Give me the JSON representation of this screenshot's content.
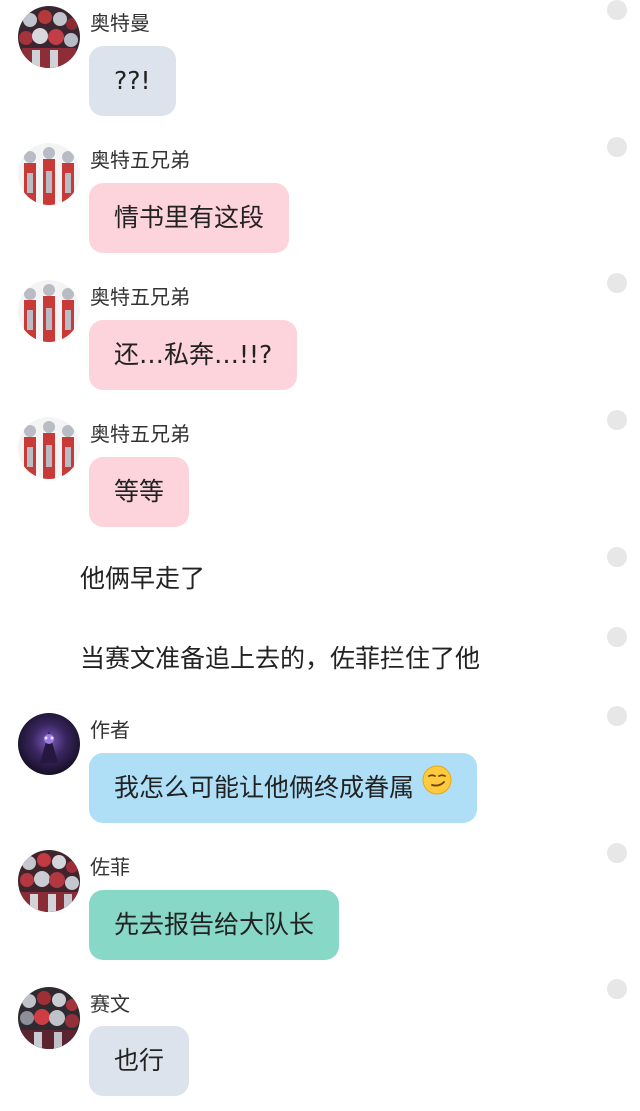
{
  "messages": [
    {
      "type": "chat",
      "speaker": "奥特曼",
      "text": "??!",
      "color": "#dde3ec",
      "avatar_icon": "ultraman-group-avatar-icon"
    },
    {
      "type": "chat",
      "speaker": "奥特五兄弟",
      "text": "情书里有这段",
      "color": "#fdd3dc",
      "avatar_icon": "ultra-brothers-avatar-icon"
    },
    {
      "type": "chat",
      "speaker": "奥特五兄弟",
      "text": "还…私奔…!!?",
      "color": "#fdd3dc",
      "avatar_icon": "ultra-brothers-avatar-icon"
    },
    {
      "type": "chat",
      "speaker": "奥特五兄弟",
      "text": "等等",
      "color": "#fdd3dc",
      "avatar_icon": "ultra-brothers-avatar-icon"
    },
    {
      "type": "narration",
      "text": "他俩早走了"
    },
    {
      "type": "narration",
      "text": "当赛文准备追上去的，佐菲拦住了他"
    },
    {
      "type": "chat",
      "speaker": "作者",
      "text": "我怎么可能让他俩终成眷属",
      "emoji": "smirk-face-emoji",
      "color": "#aedff7",
      "avatar_icon": "dark-purple-avatar-icon"
    },
    {
      "type": "chat",
      "speaker": "佐菲",
      "text": "先去报告给大队长",
      "color": "#88d8c8",
      "avatar_icon": "zoffy-avatar-icon"
    },
    {
      "type": "chat",
      "speaker": "赛文",
      "text": "也行",
      "color": "#dde3ec",
      "avatar_icon": "seven-avatar-icon"
    }
  ],
  "side_dot_color": "#e7e7e7"
}
